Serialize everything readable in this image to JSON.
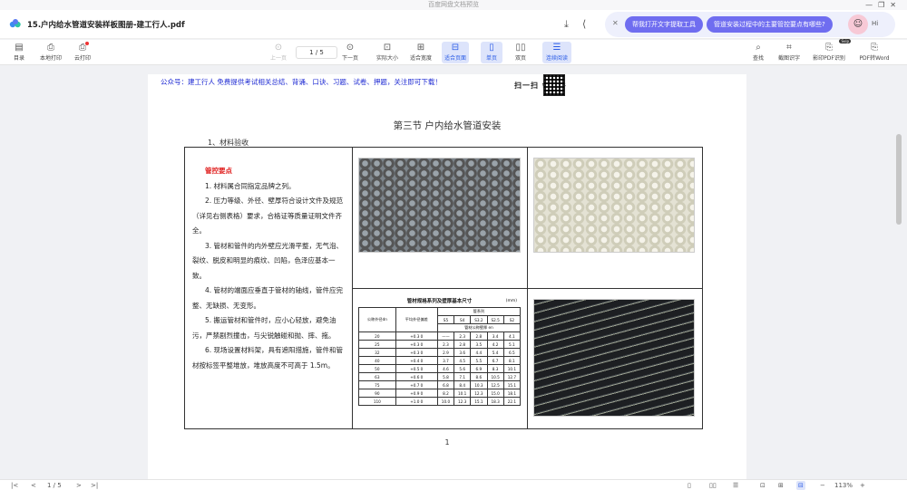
{
  "app": {
    "window_title": "百度网盘文档预览"
  },
  "document": {
    "title": "15.户内给水管道安装样板图册-建工行人.pdf"
  },
  "ai": {
    "prompt1": "帮我打开文字提取工具",
    "prompt2": "管道安装过程中的主要管控要点有哪些?",
    "greeting": "Hi"
  },
  "toolbar": {
    "catalog": "目录",
    "local_print": "本地打印",
    "cloud_print": "云打印",
    "prev_page": "上一页",
    "page_indicator": "1 / 5",
    "next_page": "下一页",
    "actual_size": "实际大小",
    "fit_width": "适合宽度",
    "fit_page": "适合页面",
    "single_page": "单页",
    "double_page": "双页",
    "continuous": "连续阅读",
    "search": "查找",
    "screenshot_ocr": "截图识字",
    "ocr_pdf": "影印PDF识别",
    "ocr_badge": "Svip",
    "pdf_to_word": "PDF转Word"
  },
  "page": {
    "promo": "公众号：建工行人 免费提供考试相关总结、背诵、口诀、习题、试卷、押题，关注即可下载！",
    "qr_label": "扫一扫      领课件",
    "section_title": "第三节  户内给水管道安装",
    "sub_title": "1、材料验收",
    "control_head": "管控要点",
    "points": [
      "1. 材料属合同指定品牌之列。",
      "2. 压力等级、外径、壁厚符合设计文件及规范（详见右侧表格）要求，合格证等质量证明文件齐全。",
      "3. 管材和管件的内外壁应光滑平整，无气泡、裂纹、脱皮和明显的痕纹、凹陷，色泽应基本一致。",
      "4. 管材的端面应垂直于管材的轴线，管件应完整、无缺损、无变形。",
      "5. 搬运管材和管件时，应小心轻放，避免油污，严禁剧烈撞击，与尖锐触碰和抛、摔、拖。",
      "6. 现场设置材料架，具有遮阳措施，管件和管材按标签平整堆放，堆放高度不可高于 1.5m。"
    ],
    "spec_title": "管材规格系列及壁厚基本尺寸",
    "spec_unit": "(mm)",
    "spec_header": [
      "公称外径dn",
      "平均外径偏差",
      "S5",
      "S4",
      "S3.2",
      "S2.5",
      "S2"
    ],
    "spec_group1": "管系列",
    "spec_group2": "管材公称壁厚 en",
    "spec_rows": [
      [
        "20",
        "+0.3 0",
        "——",
        "2.3",
        "2.8",
        "3.4",
        "4.1"
      ],
      [
        "25",
        "+0.3 0",
        "2.3",
        "2.8",
        "3.5",
        "4.2",
        "5.1"
      ],
      [
        "32",
        "+0.3 0",
        "2.9",
        "3.6",
        "4.4",
        "5.4",
        "6.5"
      ],
      [
        "40",
        "+0.4 0",
        "3.7",
        "4.5",
        "5.5",
        "6.7",
        "8.1"
      ],
      [
        "50",
        "+0.5 0",
        "4.6",
        "5.6",
        "6.9",
        "8.3",
        "10.1"
      ],
      [
        "63",
        "+0.6 0",
        "5.8",
        "7.1",
        "8.6",
        "10.5",
        "12.7"
      ],
      [
        "75",
        "+0.7 0",
        "6.8",
        "8.4",
        "10.3",
        "12.5",
        "15.1"
      ],
      [
        "90",
        "+0.9 0",
        "8.2",
        "10.1",
        "12.3",
        "15.0",
        "18.1"
      ],
      [
        "110",
        "+1.0 0",
        "10.0",
        "12.3",
        "15.1",
        "18.3",
        "22.1"
      ]
    ],
    "page_number": "1"
  },
  "status": {
    "page_indicator": "1 / 5",
    "zoom": "113%"
  },
  "icons": {
    "doc": "cloud-doc-icon",
    "download": "download-icon",
    "share": "share-icon"
  },
  "colors": {
    "accent": "#2b5ce6",
    "ai_button": "#6f6df0",
    "promo_text": "#1f2bd3",
    "head_red": "#e0201f"
  }
}
